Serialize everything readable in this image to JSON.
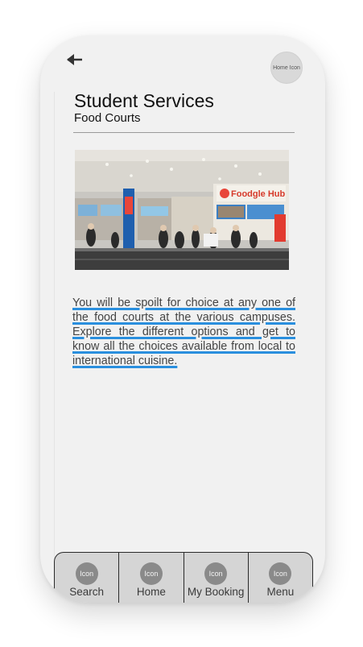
{
  "header": {
    "back_icon": "arrow-left-icon",
    "home_button_label": "Home Icon"
  },
  "page": {
    "title": "Student Services",
    "subtitle": "Food Courts"
  },
  "image": {
    "subject": "food-court-photo",
    "sign_text": "Foodgle Hub"
  },
  "content": {
    "description": "You will be spoilt for choice at any one of the food courts at the various campuses. Explore the different options and get to know all the choices available from local to international cuisine."
  },
  "bottom_nav": {
    "items": [
      {
        "icon_label": "Icon",
        "label": "Search"
      },
      {
        "icon_label": "Icon",
        "label": "Home"
      },
      {
        "icon_label": "Icon",
        "label": "My Booking"
      },
      {
        "icon_label": "Icon",
        "label": "Menu"
      }
    ]
  },
  "colors": {
    "screen_bg": "#f1f1f1",
    "nav_bg": "#d5d5d5",
    "underline": "#2a8fde",
    "icon_circle": "#8a8a8a"
  }
}
